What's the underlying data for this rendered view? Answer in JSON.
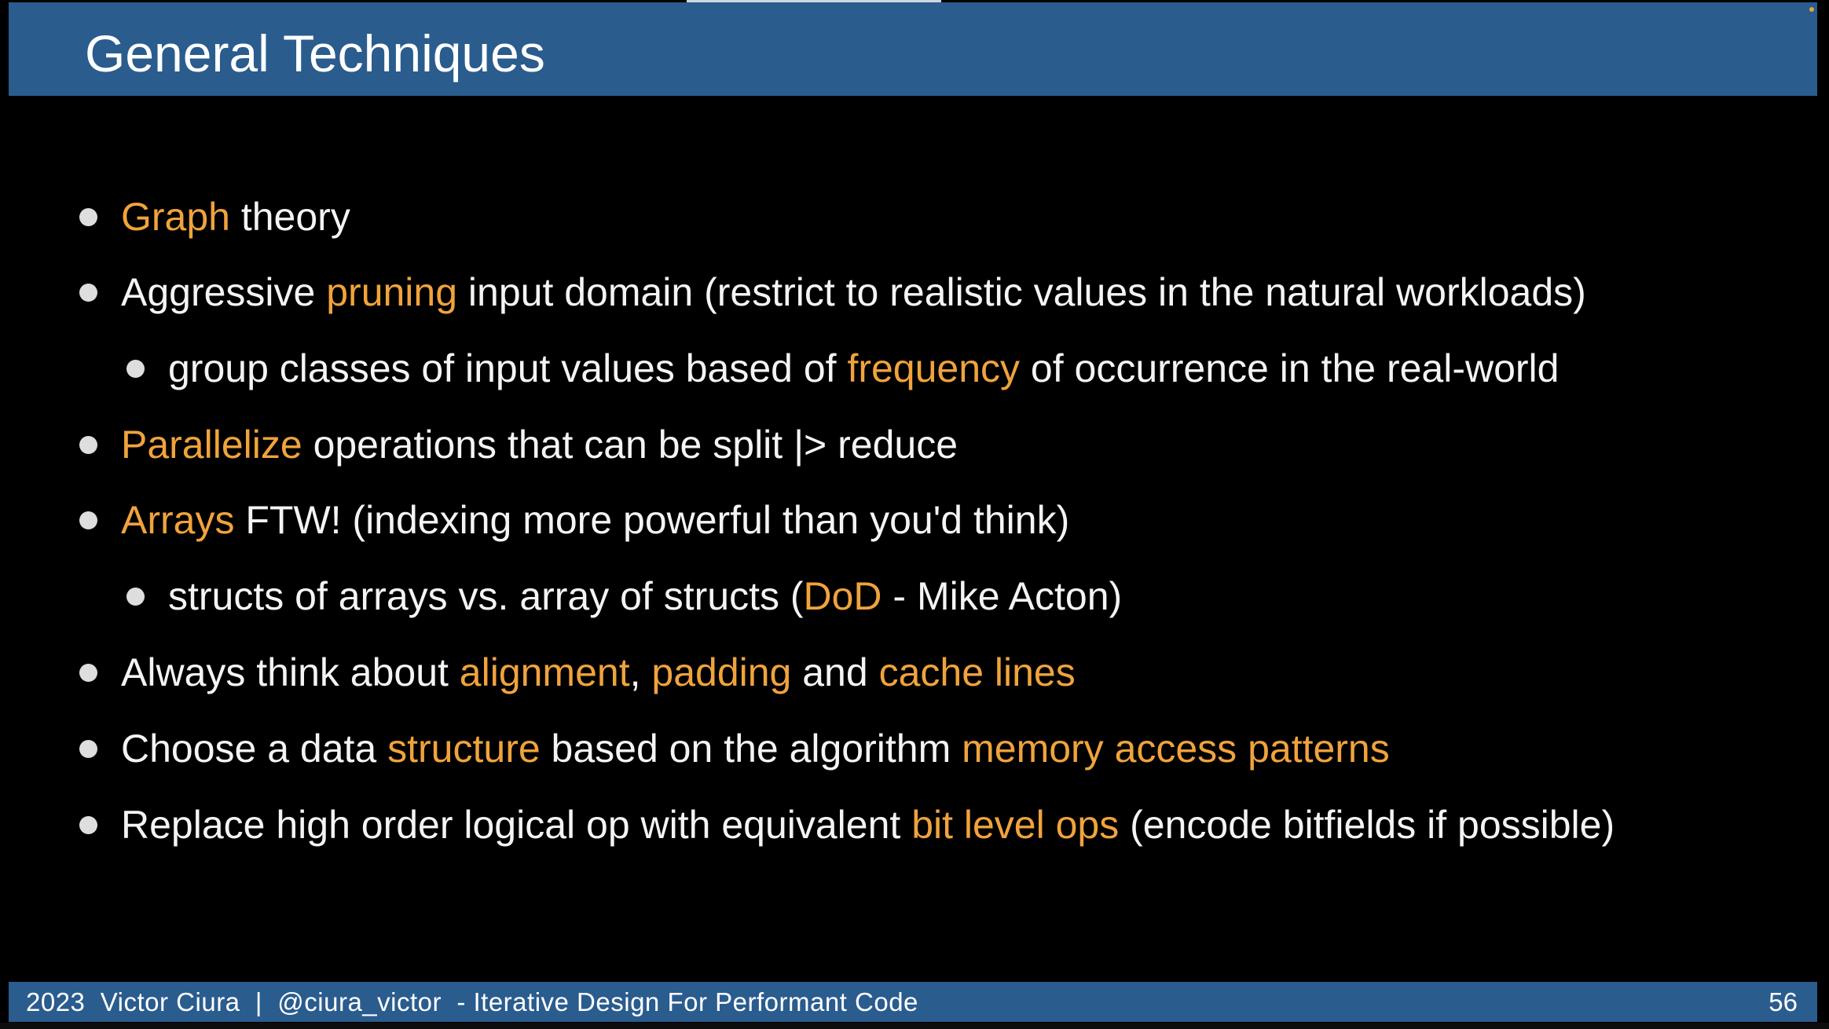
{
  "slide": {
    "title": "General Techniques",
    "bullets": [
      {
        "level": 1,
        "parts": [
          {
            "text": "Graph",
            "hl": true
          },
          {
            "text": " theory",
            "hl": false
          }
        ]
      },
      {
        "level": 1,
        "parts": [
          {
            "text": "Aggressive ",
            "hl": false
          },
          {
            "text": "pruning",
            "hl": true
          },
          {
            "text": " input domain (restrict to realistic values in the natural workloads)",
            "hl": false
          }
        ]
      },
      {
        "level": 2,
        "parts": [
          {
            "text": "group classes of input values based of ",
            "hl": false
          },
          {
            "text": "frequency",
            "hl": true
          },
          {
            "text": " of occurrence in the real-world",
            "hl": false
          }
        ]
      },
      {
        "level": 1,
        "parts": [
          {
            "text": "Parallelize",
            "hl": true
          },
          {
            "text": " operations that can be split |> reduce",
            "hl": false
          }
        ]
      },
      {
        "level": 1,
        "parts": [
          {
            "text": "Arrays",
            "hl": true
          },
          {
            "text": " FTW! (indexing more powerful than you'd think)",
            "hl": false
          }
        ]
      },
      {
        "level": 2,
        "parts": [
          {
            "text": "structs of arrays vs. array of structs (",
            "hl": false
          },
          {
            "text": "DoD",
            "hl": true
          },
          {
            "text": " - Mike Acton)",
            "hl": false
          }
        ]
      },
      {
        "level": 1,
        "parts": [
          {
            "text": "Always think about ",
            "hl": false
          },
          {
            "text": "alignment",
            "hl": true
          },
          {
            "text": ", ",
            "hl": false
          },
          {
            "text": "padding",
            "hl": true
          },
          {
            "text": " and ",
            "hl": false
          },
          {
            "text": "cache lines",
            "hl": true
          }
        ]
      },
      {
        "level": 1,
        "parts": [
          {
            "text": "Choose a data ",
            "hl": false
          },
          {
            "text": "structure",
            "hl": true
          },
          {
            "text": " based on the algorithm ",
            "hl": false
          },
          {
            "text": "memory access patterns",
            "hl": true
          }
        ]
      },
      {
        "level": 1,
        "parts": [
          {
            "text": "Replace high order logical op with equivalent ",
            "hl": false
          },
          {
            "text": "bit level ops",
            "hl": true
          },
          {
            "text": " (encode bitfields if possible)",
            "hl": false
          }
        ]
      }
    ]
  },
  "footer": {
    "text": "2023  Victor Ciura  |  @ciura_victor  - Iterative Design For Performant Code",
    "page_number": "56"
  },
  "colors": {
    "title_bar": "#2a5c8e",
    "background": "#000000",
    "highlight": "#f0a33c",
    "text": "#f4f4f4"
  }
}
